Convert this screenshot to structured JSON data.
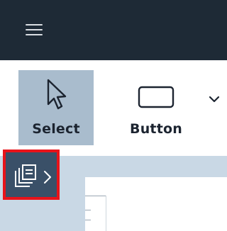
{
  "header": {
    "menu_icon": "hamburger-menu-icon"
  },
  "toolbar": {
    "tools": [
      {
        "label": "Select",
        "icon": "cursor-arrow-icon",
        "active": true
      },
      {
        "label": "Button",
        "icon": "button-rectangle-icon",
        "active": false
      }
    ],
    "dropdown_icon": "chevron-down-icon"
  },
  "pages_panel": {
    "toggle_icon": "pages-stack-icon",
    "expand_icon": "chevron-right-icon",
    "highlight_color": "#e8131a"
  },
  "colors": {
    "topbar": "#1e2a36",
    "active_tool": "#a9bccd",
    "canvas": "#c9d8e5",
    "panel": "#3a5068"
  }
}
